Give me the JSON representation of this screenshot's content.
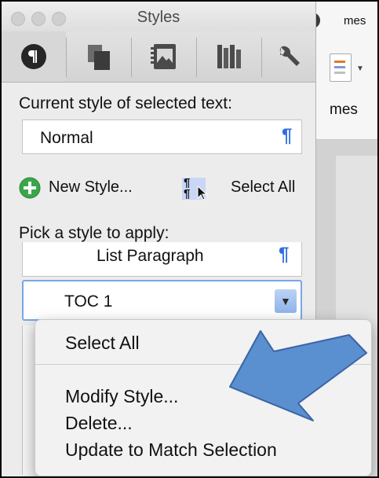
{
  "background_window": {
    "names_top": "mes",
    "names_bottom": "mes"
  },
  "palette": {
    "title": "Styles",
    "toolbar_icons": [
      "paragraph-styles-icon",
      "formatting-icon",
      "image-icon",
      "library-icon",
      "wrench-icon"
    ],
    "current_style_label": "Current style of selected text:",
    "current_style_value": "Normal",
    "new_style_label": "New Style...",
    "select_all_label": "Select All",
    "pick_style_label": "Pick a style to apply:",
    "style_list": [
      "List Paragraph",
      "TOC 1"
    ]
  },
  "context_menu": {
    "items": [
      "Select All",
      "Modify Style...",
      "Delete...",
      "Update to Match Selection"
    ]
  },
  "colors": {
    "accent_blue": "#2f6fe0",
    "annotation_arrow": "#5a8fd0",
    "add_green": "#3aa64a"
  }
}
